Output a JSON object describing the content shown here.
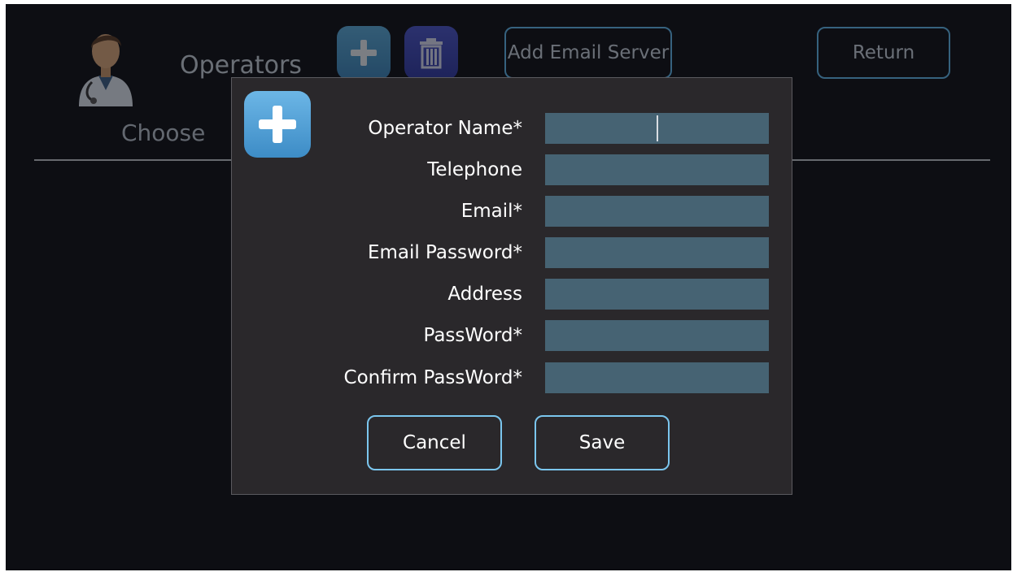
{
  "background": {
    "title": "Operators",
    "choose_label": "Choose",
    "add_email_server_label": "Add Email Server",
    "return_label": "Return",
    "icons": {
      "avatar": "doctor-avatar-icon",
      "add": "plus-icon",
      "delete": "trash-icon"
    }
  },
  "dialog": {
    "icon": "plus-icon",
    "fields": [
      {
        "label": "Operator Name*",
        "value": ""
      },
      {
        "label": "Telephone",
        "value": ""
      },
      {
        "label": "Email*",
        "value": ""
      },
      {
        "label": "Email Password*",
        "value": ""
      },
      {
        "label": "Address",
        "value": ""
      },
      {
        "label": "PassWord*",
        "value": ""
      },
      {
        "label": "Confirm PassWord*",
        "value": ""
      }
    ],
    "cancel_label": "Cancel",
    "save_label": "Save"
  },
  "colors": {
    "screen_bg": "#0d0e13",
    "dialog_bg": "#2a282b",
    "field_bg": "#466373",
    "accent": "#5fb6ea"
  }
}
